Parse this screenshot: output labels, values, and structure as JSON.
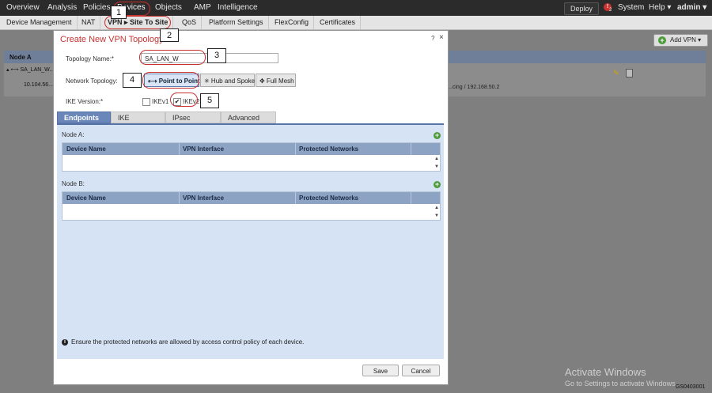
{
  "topnav": {
    "items": [
      "Overview",
      "Analysis",
      "Policies",
      "Devices",
      "Objects",
      "AMP",
      "Intelligence"
    ],
    "deploy": "Deploy",
    "alert_count": "2",
    "system": "System",
    "help": "Help ▾",
    "user": "admin ▾"
  },
  "subnav": {
    "items": [
      "Device Management",
      "NAT",
      "VPN ▸ Site To Site",
      "QoS",
      "Platform Settings",
      "FlexConfig",
      "Certificates"
    ]
  },
  "background": {
    "add_vpn": "Add VPN ▾",
    "col_node_a": "Node A",
    "row1": "▴ ⟷ SA_LAN_W...",
    "row2": "10.104.56...",
    "row_right": "...cing / 192.168.50.2"
  },
  "dialog": {
    "title": "Create New VPN Topology",
    "help": "?",
    "close": "×",
    "topology_name_label": "Topology Name:*",
    "topology_name_value": "SA_LAN_W",
    "network_topology_label": "Network Topology:",
    "topology_options": [
      "⟷ Point to Point",
      "✳ Hub and Spoke",
      "✥ Full Mesh"
    ],
    "ike_version_label": "IKE Version:*",
    "ikev1": "IKEv1",
    "ikev2": "IKEv2",
    "ikev2_checked": true,
    "tabs": [
      "Endpoints",
      "IKE",
      "IPsec",
      "Advanced"
    ],
    "node_a_label": "Node A:",
    "node_b_label": "Node B:",
    "columns": [
      "Device Name",
      "VPN Interface",
      "Protected Networks"
    ],
    "info_text": "Ensure the protected networks are allowed by access control policy of each device.",
    "save": "Save",
    "cancel": "Cancel"
  },
  "callouts": [
    "1",
    "2",
    "3",
    "4",
    "5"
  ],
  "watermark": {
    "line1": "Activate Windows",
    "line2": "Go to Settings to activate Windows.",
    "code": "GS0403001"
  },
  "colors": {
    "accent_red": "#c8322f",
    "nav_bg": "#2b2b2b",
    "panel_blue": "#d6e3f4",
    "tab_active": "#6b86b8"
  }
}
